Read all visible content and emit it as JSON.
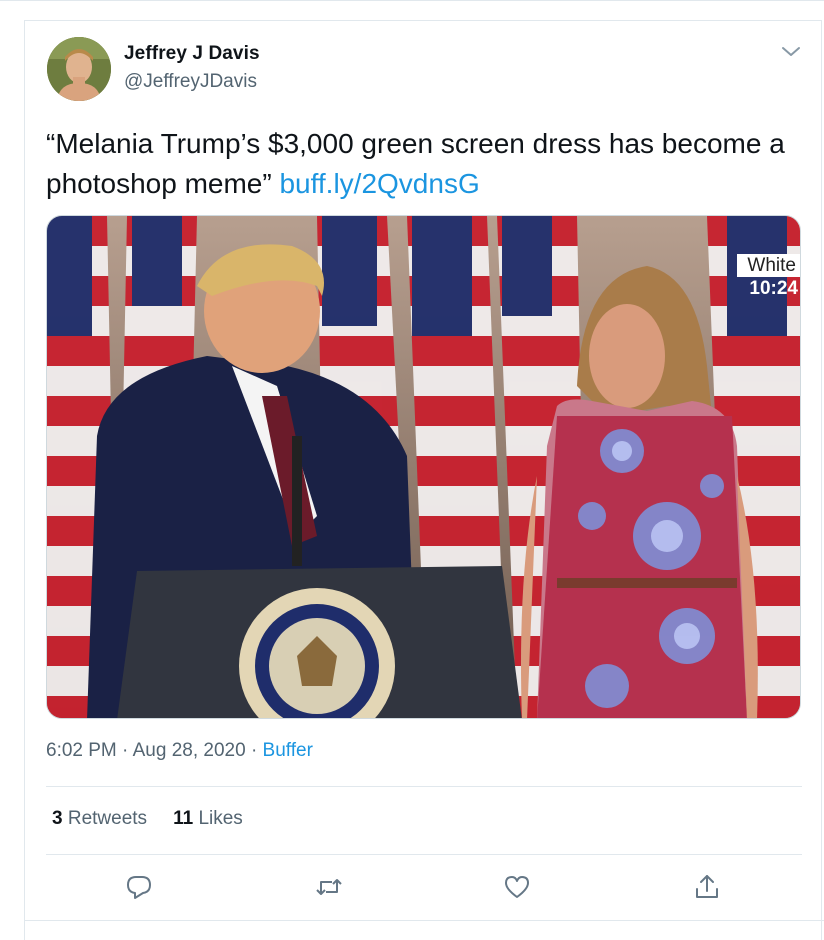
{
  "author": {
    "name": "Jeffrey J Davis",
    "handle": "@JeffreyJDavis"
  },
  "tweet": {
    "text": "“Melania Trump’s $3,000 green screen dress has become a photoshop meme”",
    "link": "buff.ly/2QvdnsG"
  },
  "media": {
    "overlay_label": "White",
    "overlay_time": "10:24"
  },
  "meta": {
    "time": "6:02 PM",
    "separator": "·",
    "date": "Aug 28, 2020",
    "source": "Buffer"
  },
  "stats": {
    "retweets_count": "3",
    "retweets_label": "Retweets",
    "likes_count": "11",
    "likes_label": "Likes"
  },
  "icons": {
    "reply": "reply-icon",
    "retweet": "retweet-icon",
    "like": "heart-icon",
    "share": "share-icon",
    "more": "chevron-down-icon"
  },
  "colors": {
    "link": "#1b95e0",
    "secondary_text": "#536471",
    "border": "#e1e8ed"
  }
}
